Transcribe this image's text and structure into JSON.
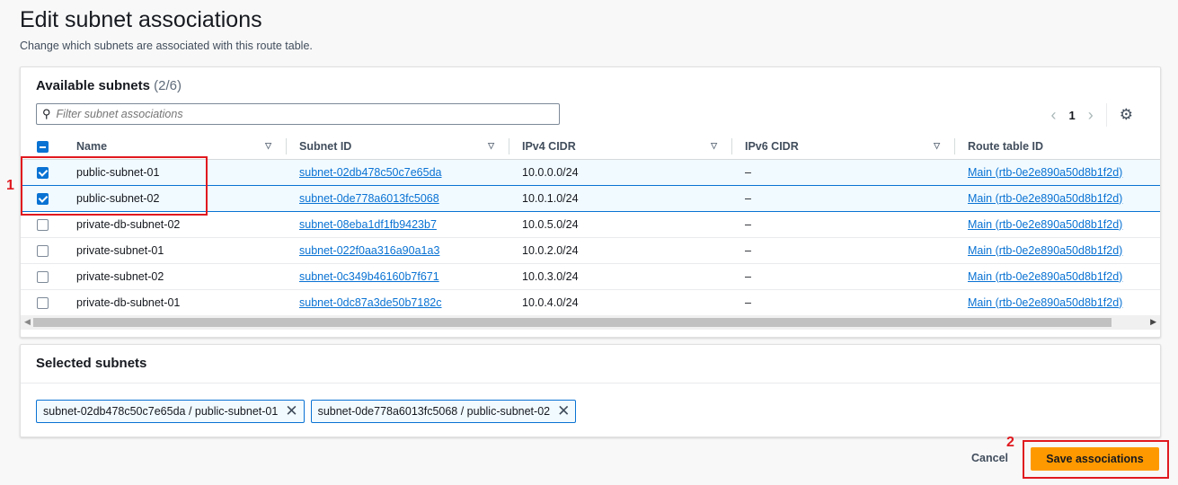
{
  "page": {
    "title": "Edit subnet associations",
    "subtitle": "Change which subnets are associated with this route table."
  },
  "available": {
    "title": "Available subnets",
    "count": "(2/6)",
    "filter_placeholder": "Filter subnet associations",
    "page": "1",
    "columns": [
      "Name",
      "Subnet ID",
      "IPv4 CIDR",
      "IPv6 CIDR",
      "Route table ID"
    ],
    "rows": [
      {
        "selected": true,
        "name": "public-subnet-01",
        "subnet_id": "subnet-02db478c50c7e65da",
        "ipv4": "10.0.0.0/24",
        "ipv6": "–",
        "route_table": "Main (rtb-0e2e890a50d8b1f2d)"
      },
      {
        "selected": true,
        "name": "public-subnet-02",
        "subnet_id": "subnet-0de778a6013fc5068",
        "ipv4": "10.0.1.0/24",
        "ipv6": "–",
        "route_table": "Main (rtb-0e2e890a50d8b1f2d)"
      },
      {
        "selected": false,
        "name": "private-db-subnet-02",
        "subnet_id": "subnet-08eba1df1fb9423b7",
        "ipv4": "10.0.5.0/24",
        "ipv6": "–",
        "route_table": "Main (rtb-0e2e890a50d8b1f2d)"
      },
      {
        "selected": false,
        "name": "private-subnet-01",
        "subnet_id": "subnet-022f0aa316a90a1a3",
        "ipv4": "10.0.2.0/24",
        "ipv6": "–",
        "route_table": "Main (rtb-0e2e890a50d8b1f2d)"
      },
      {
        "selected": false,
        "name": "private-subnet-02",
        "subnet_id": "subnet-0c349b46160b7f671",
        "ipv4": "10.0.3.0/24",
        "ipv6": "–",
        "route_table": "Main (rtb-0e2e890a50d8b1f2d)"
      },
      {
        "selected": false,
        "name": "private-db-subnet-01",
        "subnet_id": "subnet-0dc87a3de50b7182c",
        "ipv4": "10.0.4.0/24",
        "ipv6": "–",
        "route_table": "Main (rtb-0e2e890a50d8b1f2d)"
      }
    ]
  },
  "selected": {
    "title": "Selected subnets",
    "tokens": [
      "subnet-02db478c50c7e65da / public-subnet-01",
      "subnet-0de778a6013fc5068 / public-subnet-02"
    ]
  },
  "footer": {
    "cancel": "Cancel",
    "save": "Save associations"
  },
  "annotations": [
    "1",
    "2"
  ],
  "colors": {
    "accent": "#0972d3",
    "primary_button": "#ff9900",
    "annotation": "#e0191f"
  }
}
